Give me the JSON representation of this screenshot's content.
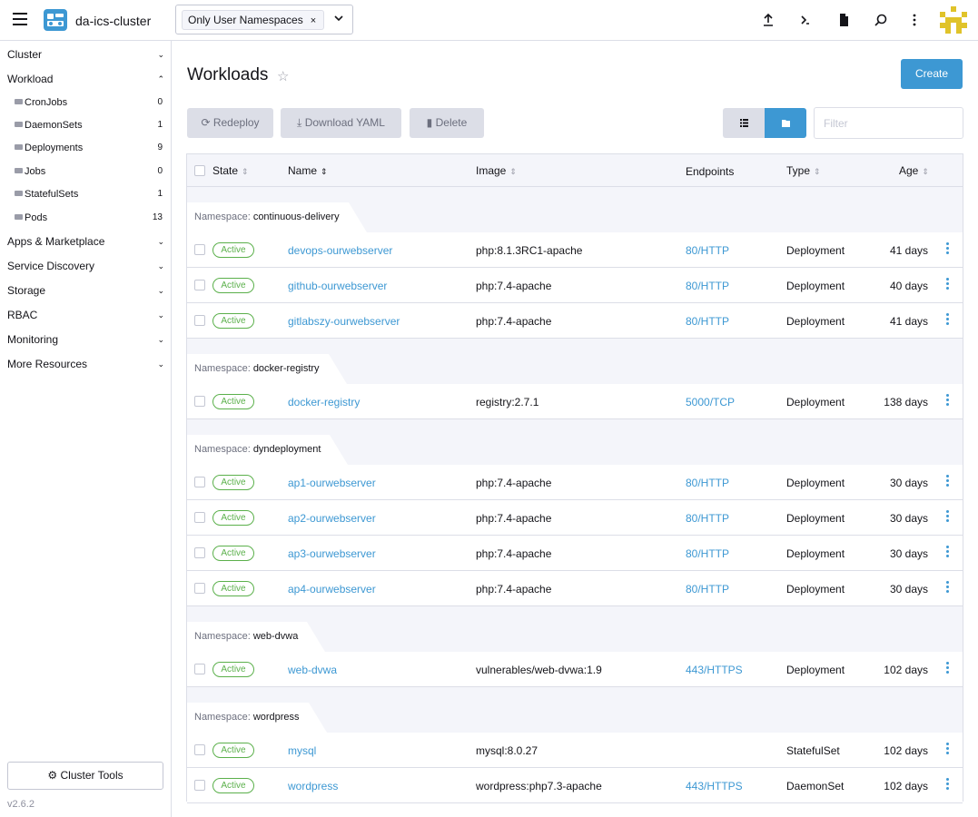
{
  "header": {
    "cluster_name": "da-ics-cluster",
    "namespace_filter": "Only User Namespaces",
    "chip_remove": "×",
    "icons": [
      "upload-icon",
      "terminal-icon",
      "file-icon",
      "search-icon",
      "kebab-icon"
    ]
  },
  "sidebar": {
    "groups": [
      {
        "label": "Cluster",
        "expanded": false
      },
      {
        "label": "Workload",
        "expanded": true
      },
      {
        "label": "Apps & Marketplace",
        "expanded": false
      },
      {
        "label": "Service Discovery",
        "expanded": false
      },
      {
        "label": "Storage",
        "expanded": false
      },
      {
        "label": "RBAC",
        "expanded": false
      },
      {
        "label": "Monitoring",
        "expanded": false
      },
      {
        "label": "More Resources",
        "expanded": false
      }
    ],
    "workload_items": [
      {
        "label": "CronJobs",
        "count": "0"
      },
      {
        "label": "DaemonSets",
        "count": "1"
      },
      {
        "label": "Deployments",
        "count": "9"
      },
      {
        "label": "Jobs",
        "count": "0"
      },
      {
        "label": "StatefulSets",
        "count": "1"
      },
      {
        "label": "Pods",
        "count": "13"
      }
    ],
    "cluster_tools": "Cluster Tools",
    "version": "v2.6.2"
  },
  "main": {
    "title": "Workloads",
    "star": "☆",
    "create": "Create",
    "redeploy": "Redeploy",
    "download_yaml": "Download YAML",
    "delete": "Delete",
    "filter_placeholder": "Filter"
  },
  "table": {
    "columns": {
      "state": "State",
      "name": "Name",
      "image": "Image",
      "endpoints": "Endpoints",
      "type": "Type",
      "age": "Age"
    },
    "namespace_label": "Namespace:",
    "groups": [
      {
        "namespace": "continuous-delivery",
        "rows": [
          {
            "state": "Active",
            "name": "devops-ourwebserver",
            "image": "php:8.1.3RC1-apache",
            "endpoint": "80/HTTP",
            "type": "Deployment",
            "age": "41 days"
          },
          {
            "state": "Active",
            "name": "github-ourwebserver",
            "image": "php:7.4-apache",
            "endpoint": "80/HTTP",
            "type": "Deployment",
            "age": "40 days"
          },
          {
            "state": "Active",
            "name": "gitlabszy-ourwebserver",
            "image": "php:7.4-apache",
            "endpoint": "80/HTTP",
            "type": "Deployment",
            "age": "41 days"
          }
        ]
      },
      {
        "namespace": "docker-registry",
        "rows": [
          {
            "state": "Active",
            "name": "docker-registry",
            "image": "registry:2.7.1",
            "endpoint": "5000/TCP",
            "type": "Deployment",
            "age": "138 days"
          }
        ]
      },
      {
        "namespace": "dyndeployment",
        "rows": [
          {
            "state": "Active",
            "name": "ap1-ourwebserver",
            "image": "php:7.4-apache",
            "endpoint": "80/HTTP",
            "type": "Deployment",
            "age": "30 days"
          },
          {
            "state": "Active",
            "name": "ap2-ourwebserver",
            "image": "php:7.4-apache",
            "endpoint": "80/HTTP",
            "type": "Deployment",
            "age": "30 days"
          },
          {
            "state": "Active",
            "name": "ap3-ourwebserver",
            "image": "php:7.4-apache",
            "endpoint": "80/HTTP",
            "type": "Deployment",
            "age": "30 days"
          },
          {
            "state": "Active",
            "name": "ap4-ourwebserver",
            "image": "php:7.4-apache",
            "endpoint": "80/HTTP",
            "type": "Deployment",
            "age": "30 days"
          }
        ]
      },
      {
        "namespace": "web-dvwa",
        "rows": [
          {
            "state": "Active",
            "name": "web-dvwa",
            "image": "vulnerables/web-dvwa:1.9",
            "endpoint": "443/HTTPS",
            "type": "Deployment",
            "age": "102 days"
          }
        ]
      },
      {
        "namespace": "wordpress",
        "rows": [
          {
            "state": "Active",
            "name": "mysql",
            "image": "mysql:8.0.27",
            "endpoint": "",
            "type": "StatefulSet",
            "age": "102 days"
          },
          {
            "state": "Active",
            "name": "wordpress",
            "image": "wordpress:php7.3-apache",
            "endpoint": "443/HTTPS",
            "type": "DaemonSet",
            "age": "102 days"
          }
        ]
      }
    ]
  },
  "colors": {
    "accent": "#3d98d3",
    "active": "#5bb04b",
    "muted_bg": "#f4f5fa",
    "border": "#dcdee7"
  }
}
